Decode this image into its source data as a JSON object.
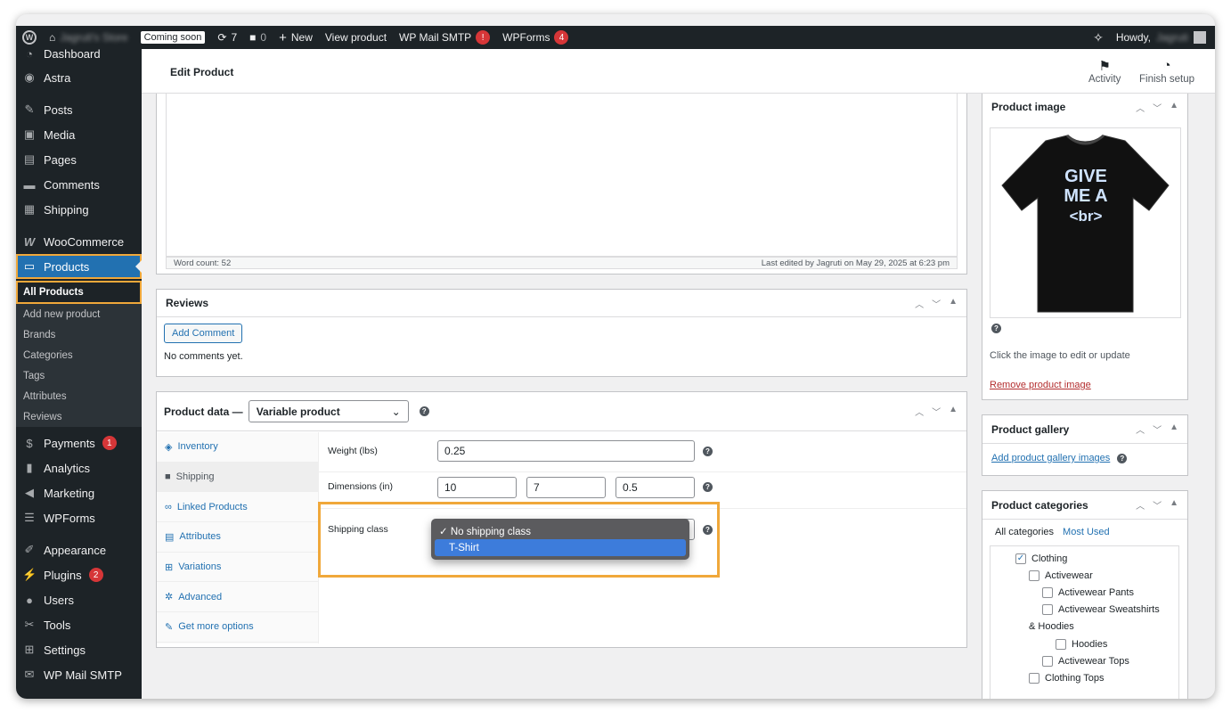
{
  "adminbar": {
    "site_name": "Jagruti's Store",
    "coming_soon": "Coming soon",
    "updates": "7",
    "comments": "0",
    "new": "New",
    "view_product": "View product",
    "smtp": "WP Mail SMTP",
    "smtp_badge": "!",
    "wpforms": "WPForms",
    "wpforms_badge": "4",
    "howdy": "Howdy,",
    "user": "Jagruti"
  },
  "sidebar": {
    "dashboard": "Dashboard",
    "astra": "Astra",
    "posts": "Posts",
    "media": "Media",
    "pages": "Pages",
    "comments": "Comments",
    "shipping": "Shipping",
    "woocommerce": "WooCommerce",
    "products": "Products",
    "sub": [
      "All Products",
      "Add new product",
      "Brands",
      "Categories",
      "Tags",
      "Attributes",
      "Reviews"
    ],
    "payments": "Payments",
    "payments_badge": "1",
    "analytics": "Analytics",
    "marketing": "Marketing",
    "wpforms": "WPForms",
    "appearance": "Appearance",
    "plugins": "Plugins",
    "plugins_badge": "2",
    "users": "Users",
    "tools": "Tools",
    "settings": "Settings",
    "smtp": "WP Mail SMTP"
  },
  "header": {
    "title": "Edit Product",
    "activity": "Activity",
    "finish_setup": "Finish setup"
  },
  "editor": {
    "word_count": "Word count: 52",
    "last_edited": "Last edited by Jagruti on May 29, 2025 at 6:23 pm"
  },
  "reviews": {
    "title": "Reviews",
    "add_comment": "Add Comment",
    "empty": "No comments yet."
  },
  "product_data": {
    "title": "Product data —",
    "type": "Variable product",
    "tabs": [
      "Inventory",
      "Shipping",
      "Linked Products",
      "Attributes",
      "Variations",
      "Advanced",
      "Get more options"
    ],
    "weight_label": "Weight (lbs)",
    "weight": "0.25",
    "dimensions_label": "Dimensions (in)",
    "length": "10",
    "width": "7",
    "height": "0.5",
    "shipping_class_label": "Shipping class",
    "shipping_options": [
      "✓ No shipping class",
      "T-Shirt"
    ]
  },
  "product_image": {
    "title": "Product image",
    "shirt_text": [
      "GIVE",
      "ME A",
      "<br>"
    ],
    "hint": "Click the image to edit or update",
    "remove": "Remove product image"
  },
  "gallery": {
    "title": "Product gallery",
    "add": "Add product gallery images"
  },
  "categories": {
    "title": "Product categories",
    "tab_all": "All categories",
    "tab_used": "Most Used",
    "items": [
      {
        "label": "Clothing",
        "checked": true,
        "indent": 0
      },
      {
        "label": "Activewear",
        "checked": false,
        "indent": 1
      },
      {
        "label": "Activewear Pants",
        "checked": false,
        "indent": 2
      },
      {
        "label": "Activewear Sweatshirts",
        "checked": false,
        "indent": 2
      },
      {
        "label": "& Hoodies",
        "checked": false,
        "indent": 1
      },
      {
        "label": "Hoodies",
        "checked": false,
        "indent": 3
      },
      {
        "label": "Activewear Tops",
        "checked": false,
        "indent": 2
      },
      {
        "label": "Clothing Tops",
        "checked": false,
        "indent": 1
      }
    ]
  },
  "colors": {
    "accent": "#2271b1",
    "highlight": "#f0a83a",
    "adminbar": "#1d2327"
  }
}
